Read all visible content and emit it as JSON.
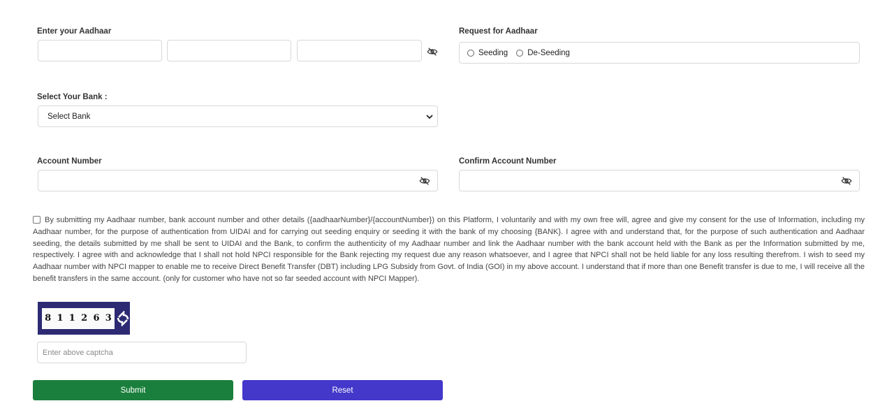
{
  "aadhaar": {
    "label": "Enter your Aadhaar",
    "field1": "",
    "field2": "",
    "field3": ""
  },
  "request": {
    "label": "Request for Aadhaar",
    "options": [
      "Seeding",
      "De-Seeding"
    ]
  },
  "bank": {
    "label": "Select Your Bank :",
    "selected": "Select Bank"
  },
  "account": {
    "label": "Account Number",
    "value": ""
  },
  "confirm_account": {
    "label": "Confirm Account Number",
    "value": ""
  },
  "consent": {
    "text": "By submitting my Aadhaar number, bank account number and other details ({aadhaarNumber}/{accountNumber}) on this Platform, I voluntarily and with my own free will, agree and give my consent for the use of Information, including my Aadhaar number, for the purpose of authentication from UIDAI and for carrying out seeding enquiry or seeding it with the bank of my choosing {BANK}. I agree with and understand that, for the purpose of such authentication and Aadhaar seeding, the details submitted by me shall be sent to UIDAI and the Bank, to confirm the authenticity of my Aadhaar number and link the Aadhaar number with the bank account held with the Bank as per the Information submitted by me, respectively. I agree with and acknowledge that I shall not hold NPCI responsible for the Bank rejecting my request due any reason whatsoever, and I agree that NPCI shall not be held liable for any loss resulting therefrom. I wish to seed my Aadhaar number with NPCI mapper to enable me to receive Direct Benefit Transfer (DBT) including LPG Subsidy from Govt. of India (GOI) in my above account. I understand that if more than one Benefit transfer is due to me, I will receive all the benefit transfers in the same account. (only for customer who have not so far seeded account with NPCI Mapper)."
  },
  "captcha": {
    "digits": [
      "8",
      "1",
      "1",
      "2",
      "6",
      "3"
    ],
    "placeholder": "Enter above captcha"
  },
  "buttons": {
    "submit": "Submit",
    "reset": "Reset"
  },
  "colors": {
    "submit": "#1a7f3c",
    "reset": "#4338ca",
    "captcha_bg": "#2d2a73"
  }
}
